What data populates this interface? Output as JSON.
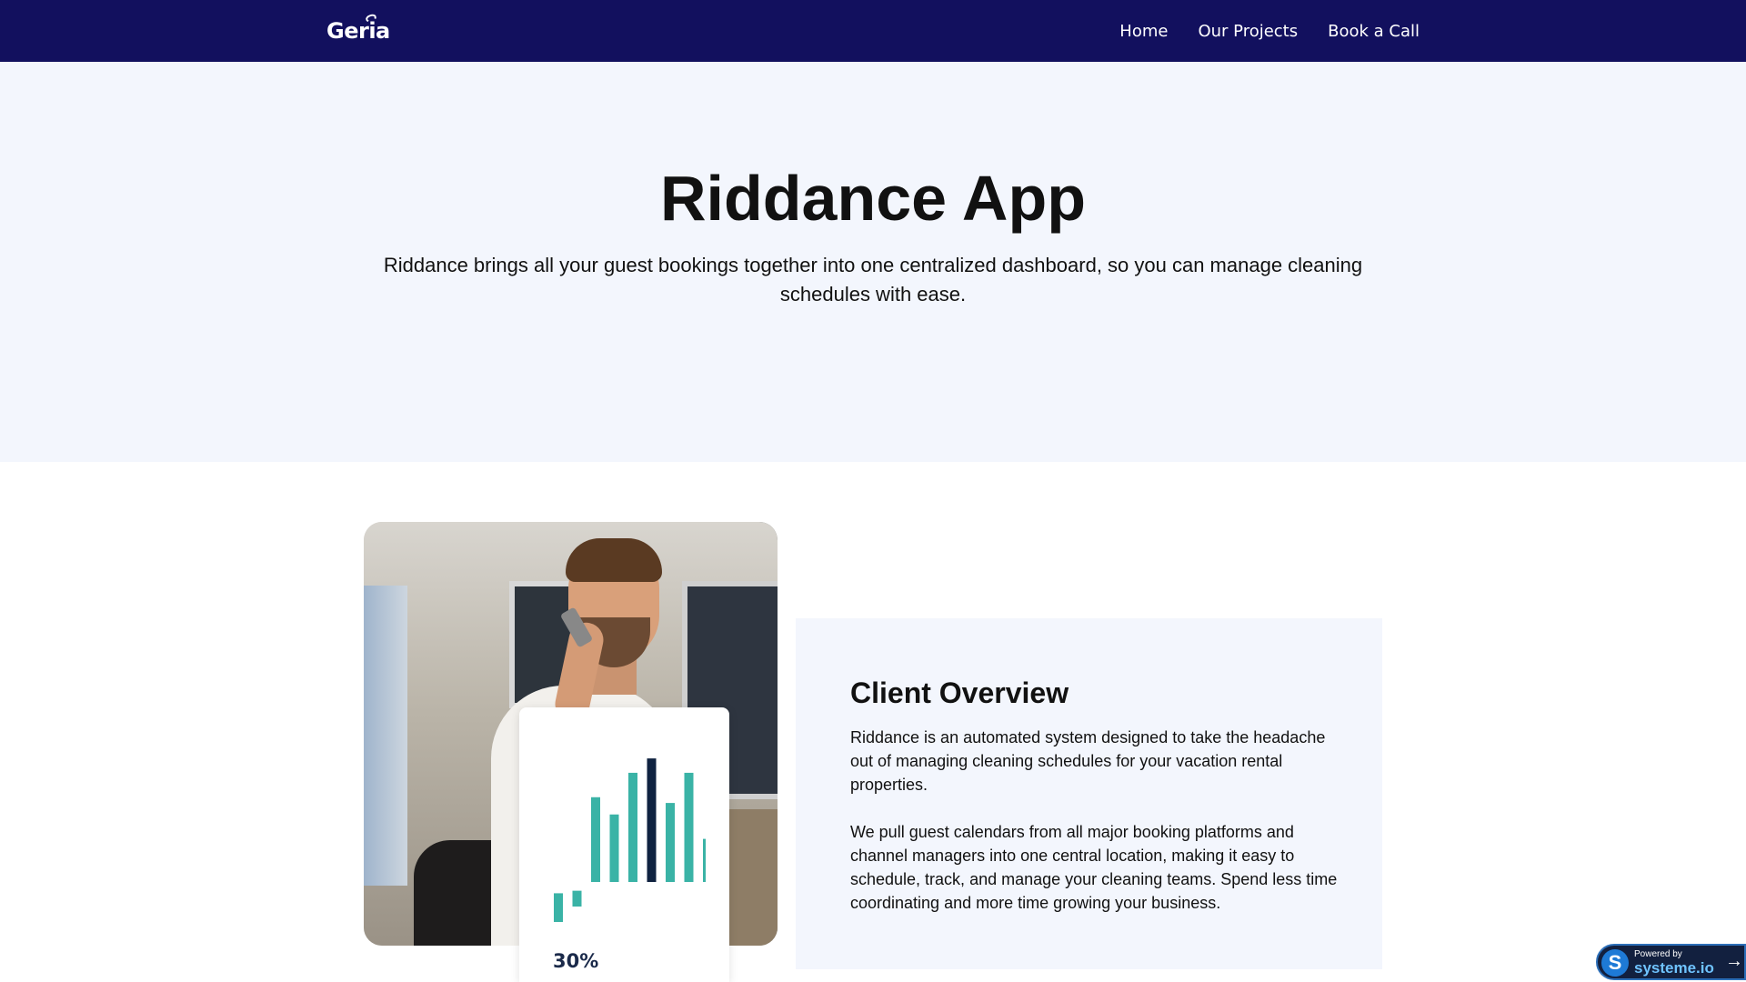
{
  "nav": {
    "logo": "Geria",
    "links": [
      "Home",
      "Our Projects",
      "Book a Call"
    ]
  },
  "hero": {
    "title": "Riddance App",
    "subtitle": "Riddance brings all your guest bookings together into one centralized dashboard, so you can manage cleaning schedules with ease."
  },
  "stat_card": {
    "value": "30%",
    "bars": [
      0.2,
      0.11,
      0.59,
      0.47,
      0.76,
      0.86,
      0.55,
      0.76,
      0.3
    ],
    "highlight_index": 5,
    "colors": {
      "bar": "#3ab3a6",
      "highlight": "#0f2240"
    }
  },
  "overview": {
    "title": "Client Overview",
    "paragraph1": "Riddance is an automated system designed to take the headache out of managing cleaning schedules for your vacation rental properties.",
    "paragraph2": "We pull guest calendars from all major booking platforms and channel managers into one central location, making it easy to schedule, track, and manage your cleaning teams. Spend less time coordinating and more time growing your business."
  },
  "badge": {
    "small": "Powered by",
    "brand": "systeme.io"
  },
  "colors": {
    "nav_bg": "#12105e",
    "hero_bg": "#f3f6fd"
  }
}
